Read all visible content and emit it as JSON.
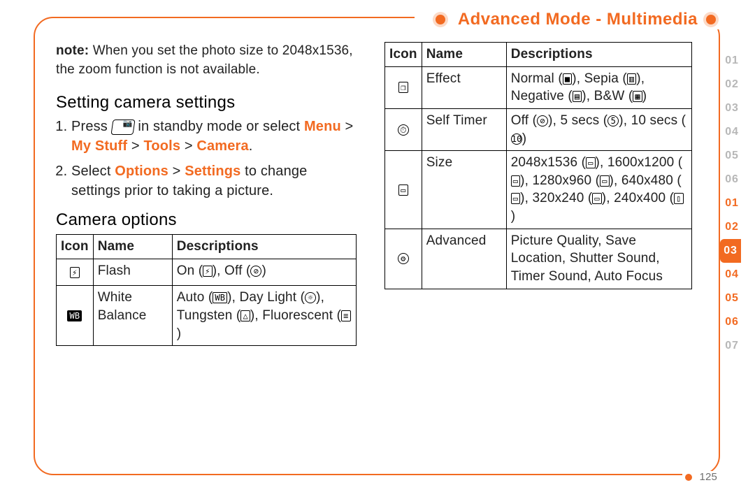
{
  "header": {
    "title": "Advanced Mode - Multimedia"
  },
  "page_number": "125",
  "note": {
    "label": "note:",
    "body": "When you set the photo size to 2048x1536, the zoom function is not available."
  },
  "sections": {
    "setting_camera": {
      "heading": "Setting camera settings",
      "steps": [
        {
          "pre": "Press ",
          "post": " in standby mode or select ",
          "path": [
            "Menu",
            "My Stuff",
            "Tools",
            "Camera"
          ],
          "tail": "."
        },
        {
          "pre": "Select ",
          "path": [
            "Options",
            "Settings"
          ],
          "post2": " to change settings prior to taking a picture."
        }
      ]
    },
    "camera_options": {
      "heading": "Camera options"
    }
  },
  "table_left": {
    "headers": [
      "Icon",
      "Name",
      "Descriptions"
    ],
    "rows": [
      {
        "icon": "flash",
        "name": "Flash",
        "desc_parts": [
          "On (",
          "flash-on",
          "), Off (",
          "flash-off",
          ")"
        ]
      },
      {
        "icon": "wb",
        "name": "White Balance",
        "desc_parts": [
          "Auto (",
          "wb-auto",
          "), Day Light (",
          "wb-day",
          "), Tungsten (",
          "wb-tung",
          "), Fluorescent (",
          "wb-fluo",
          ")"
        ]
      }
    ]
  },
  "table_right": {
    "headers": [
      "Icon",
      "Name",
      "Descriptions"
    ],
    "rows": [
      {
        "icon": "effect",
        "name": "Effect",
        "desc_parts": [
          "Normal (",
          "fx-norm",
          "), Sepia (",
          "fx-sep",
          "), Negative (",
          "fx-neg",
          "), B&W (",
          "fx-bw",
          ")"
        ]
      },
      {
        "icon": "timer",
        "name": "Self Timer",
        "desc_parts": [
          "Off (",
          "t-off",
          "), 5 secs (",
          "t-5",
          "), 10 secs (",
          "t-10",
          ")"
        ]
      },
      {
        "icon": "size",
        "name": "Size",
        "desc_parts": [
          "2048x1536 (",
          "sz-2048",
          "), 1600x1200 (",
          "sz-1600",
          "), 1280x960 (",
          "sz-1280",
          "), 640x480 (",
          "sz-640",
          "), 320x240 (",
          "sz-320",
          "), 240x400 (",
          "sz-240",
          ")"
        ]
      },
      {
        "icon": "gear",
        "name": "Advanced",
        "desc_plain": "Picture Quality, Save Location, Shutter Sound, Timer Sound, Auto Focus"
      }
    ]
  },
  "tabs": [
    {
      "label": "01",
      "state": "ghost"
    },
    {
      "label": "02",
      "state": "ghost"
    },
    {
      "label": "03",
      "state": "ghost"
    },
    {
      "label": "04",
      "state": "ghost"
    },
    {
      "label": "05",
      "state": "ghost"
    },
    {
      "label": "06",
      "state": "ghost"
    },
    {
      "label": "01",
      "state": "on"
    },
    {
      "label": "02",
      "state": "on"
    },
    {
      "label": "03",
      "state": "active"
    },
    {
      "label": "04",
      "state": "on"
    },
    {
      "label": "05",
      "state": "on"
    },
    {
      "label": "06",
      "state": "on"
    },
    {
      "label": "07",
      "state": "ghost"
    }
  ],
  "icons": {
    "flash": {
      "glyph": "⚡",
      "class": ""
    },
    "flash-on": {
      "glyph": "⚡",
      "class": ""
    },
    "flash-off": {
      "glyph": "⊘",
      "class": "round"
    },
    "wb": {
      "glyph": "WB",
      "class": "inv"
    },
    "wb-auto": {
      "glyph": "WB",
      "class": ""
    },
    "wb-day": {
      "glyph": "☼",
      "class": "round"
    },
    "wb-tung": {
      "glyph": "△",
      "class": ""
    },
    "wb-fluo": {
      "glyph": "≡",
      "class": ""
    },
    "effect": {
      "glyph": "❐",
      "class": ""
    },
    "fx-norm": {
      "glyph": "■",
      "class": ""
    },
    "fx-sep": {
      "glyph": "▥",
      "class": ""
    },
    "fx-neg": {
      "glyph": "▤",
      "class": ""
    },
    "fx-bw": {
      "glyph": "▦",
      "class": ""
    },
    "timer": {
      "glyph": "⏱",
      "class": "round"
    },
    "t-off": {
      "glyph": "⊘",
      "class": "round"
    },
    "t-5": {
      "glyph": "5",
      "class": "round"
    },
    "t-10": {
      "glyph": "10",
      "class": "round"
    },
    "size": {
      "glyph": "▭",
      "class": ""
    },
    "sz-2048": {
      "glyph": "▭",
      "class": ""
    },
    "sz-1600": {
      "glyph": "▭",
      "class": ""
    },
    "sz-1280": {
      "glyph": "▭",
      "class": ""
    },
    "sz-640": {
      "glyph": "▭",
      "class": ""
    },
    "sz-320": {
      "glyph": "▭",
      "class": ""
    },
    "sz-240": {
      "glyph": "▯",
      "class": ""
    },
    "gear": {
      "glyph": "⚙",
      "class": "round"
    }
  }
}
